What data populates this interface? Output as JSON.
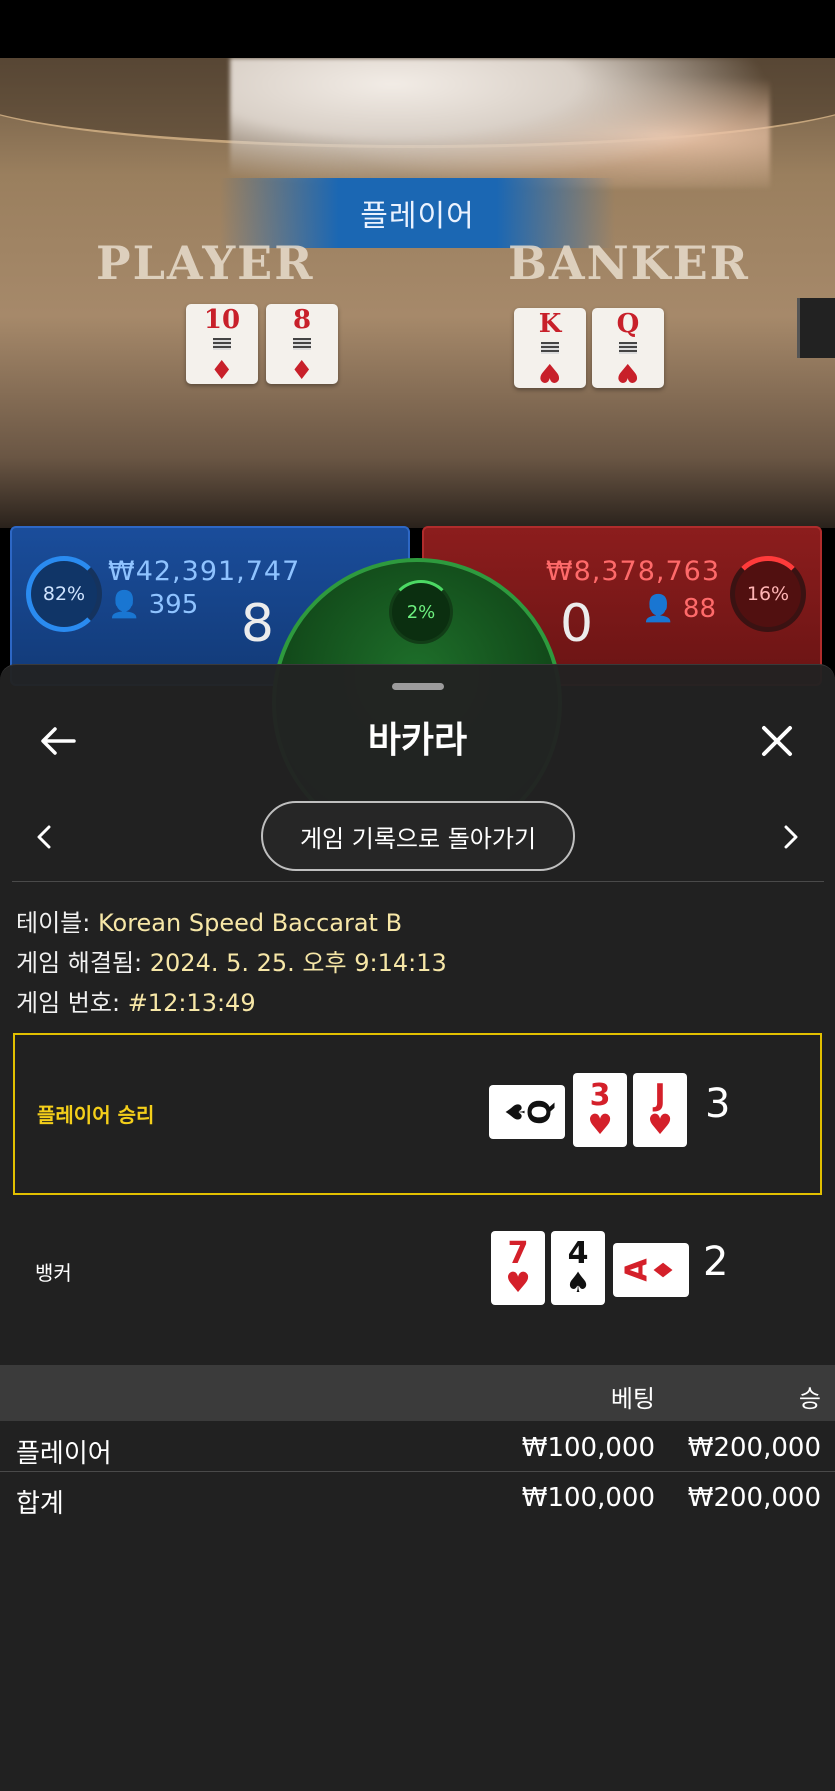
{
  "video": {
    "result_banner": "플레이어",
    "felt_player_label": "PLAYER",
    "felt_banker_label": "BANKER",
    "player_cards": [
      {
        "rank": "10",
        "suit": "♦"
      },
      {
        "rank": "8",
        "suit": "♦"
      }
    ],
    "banker_cards": [
      {
        "rank": "K",
        "suit": "♥"
      },
      {
        "rank": "Q",
        "suit": "♥"
      }
    ]
  },
  "scoreboard": {
    "player": {
      "percent": "82%",
      "pot": "₩42,391,747",
      "count": "395",
      "score": "8"
    },
    "banker": {
      "percent": "16%",
      "pot": "₩8,378,763",
      "count": "88",
      "score": "0"
    },
    "tie": {
      "percent": "2%"
    }
  },
  "sheet": {
    "title": "바카라",
    "back_to_history": "게임 기록으로 돌아가기",
    "info": {
      "table_label": "테이블:",
      "table_value": "Korean Speed Baccarat B",
      "resolved_label": "게임 해결됨:",
      "resolved_value": "2024. 5. 25. 오후 9:14:13",
      "game_no_label": "게임 번호:",
      "game_no_value": "#12:13:49"
    },
    "hands": [
      {
        "label": "플레이어 승리",
        "winner": true,
        "cards": [
          {
            "rank": "Q",
            "suit": "♠",
            "color": "black",
            "sideways": true
          },
          {
            "rank": "3",
            "suit": "♥",
            "color": "red",
            "sideways": false
          },
          {
            "rank": "J",
            "suit": "♥",
            "color": "red",
            "sideways": false
          }
        ],
        "total": "3"
      },
      {
        "label": "뱅커",
        "winner": false,
        "cards": [
          {
            "rank": "7",
            "suit": "♥",
            "color": "red",
            "sideways": false
          },
          {
            "rank": "4",
            "suit": "♠",
            "color": "black",
            "sideways": false
          },
          {
            "rank": "A",
            "suit": "♦",
            "color": "red",
            "sideways": true
          }
        ],
        "total": "2"
      }
    ],
    "bets": {
      "col_bet": "베팅",
      "col_win": "승",
      "rows": [
        {
          "name": "플레이어",
          "bet": "₩100,000",
          "win": "₩200,000"
        },
        {
          "name": "합계",
          "bet": "₩100,000",
          "win": "₩200,000"
        }
      ]
    }
  },
  "colors": {
    "winner_border": "#e2c000",
    "winner_label": "#f4cf1a",
    "info_value": "#f7e7a7"
  }
}
